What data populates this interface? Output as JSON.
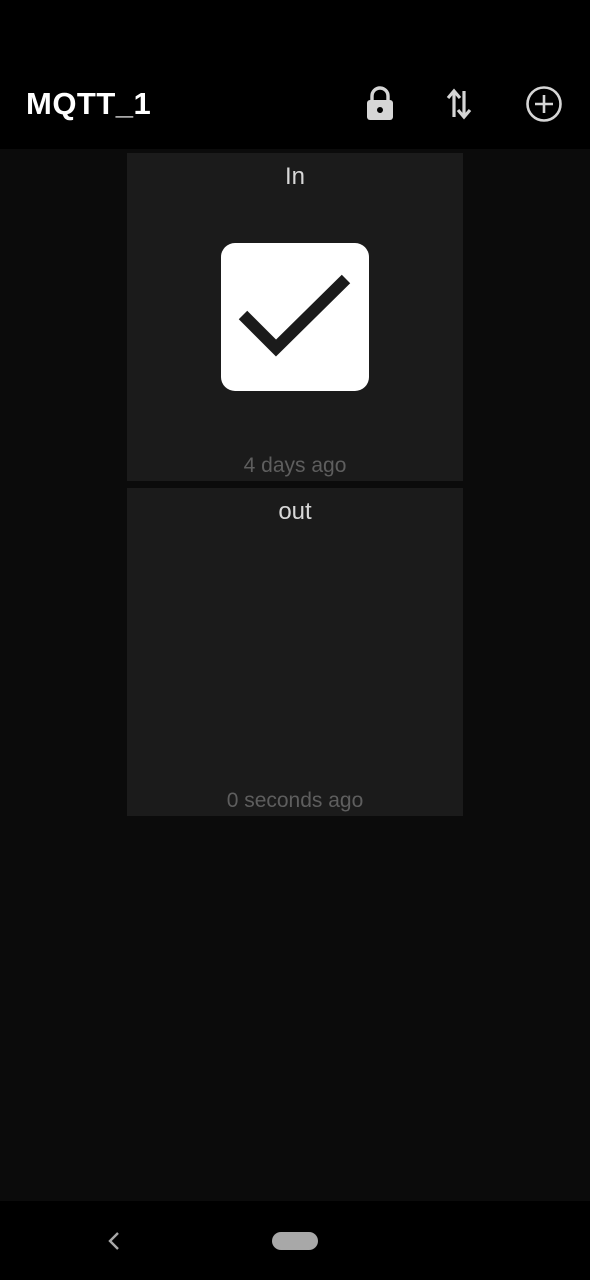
{
  "app_bar": {
    "title": "MQTT_1",
    "actions": [
      {
        "icon": "lock-icon"
      },
      {
        "icon": "sort-arrows-icon"
      },
      {
        "icon": "add-circle-icon"
      }
    ]
  },
  "tiles": [
    {
      "title": "In",
      "widget": "checkbox",
      "checked": true,
      "updated": "4 days ago"
    },
    {
      "title": "out",
      "widget": "empty",
      "updated": "0 seconds ago"
    }
  ],
  "nav_bar": {
    "back_icon": "back-chevron-icon",
    "home_icon": "home-pill-icon"
  },
  "colors": {
    "background": "#0b0b0b",
    "bars": "#000000",
    "tile": "#1b1b1b",
    "tile_title": "#d8d8d8",
    "timestamp": "#5e5e5e",
    "checkbox_fill": "#ffffff",
    "checkmark": "#1b1b1b"
  }
}
